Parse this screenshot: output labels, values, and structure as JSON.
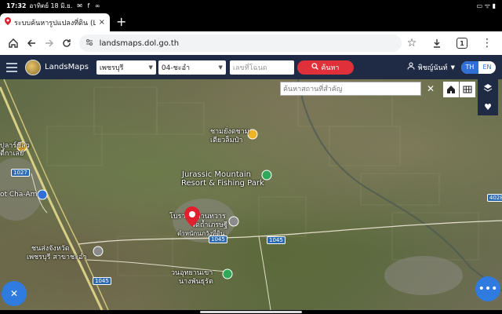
{
  "status_bar": {
    "time": "17:32",
    "date": "อาทิตย์ 18 มิ.ย.",
    "notif_icons": "✉ f ∞",
    "right_icons": "▭ ᯤ ▮"
  },
  "browser": {
    "tab_title": "ระบบค้นหารูปแปลงที่ดิน (Land",
    "tab_close": "×",
    "new_tab": "+",
    "url": "landsmaps.dol.go.th",
    "tab_count": "1"
  },
  "app": {
    "name": "LandsMaps",
    "province": "เพชรบุรี",
    "district": "04-ชะอำ",
    "plot_placeholder": "เลขที่โฉนด",
    "search_label": "ค้นหา",
    "user_name": "พิชญ์นันท์",
    "lang_th": "TH",
    "lang_en": "EN"
  },
  "map": {
    "place_search_placeholder": "ค้นหาสถานที่สำคัญ",
    "labels": {
      "top_left_poi": "ปลาร์ชีลว\nตี้กาเลย์",
      "resort_1": "Jurassic Mountain",
      "resort_2": "Resort & Fishing Park",
      "temple_1": "ชามยั่งตชาม",
      "temple_2": "เตียวล็มป๋า",
      "cha_am": "ot Cha-Am",
      "center_1": "โบราณสถานทวาร",
      "center_2": "วัดถ้ำเภรษฐี",
      "center_3": "ตำหนักนภวังที่ดิน",
      "left_1": "ชนส่งจังหวัด",
      "left_2": "เพชรบุรี สาขาชะอำ",
      "bottom_1": "วนอุทยานเขา",
      "bottom_2": "นางพันธุรัต",
      "right_edge": "SO"
    },
    "road_signs": [
      "1027",
      "1045",
      "1045",
      "1045",
      "4028"
    ]
  },
  "colors": {
    "appbar": "#1f2a44",
    "search_button": "#e0313b",
    "accent_blue": "#2f6fd6",
    "pin": "#e0202c"
  }
}
